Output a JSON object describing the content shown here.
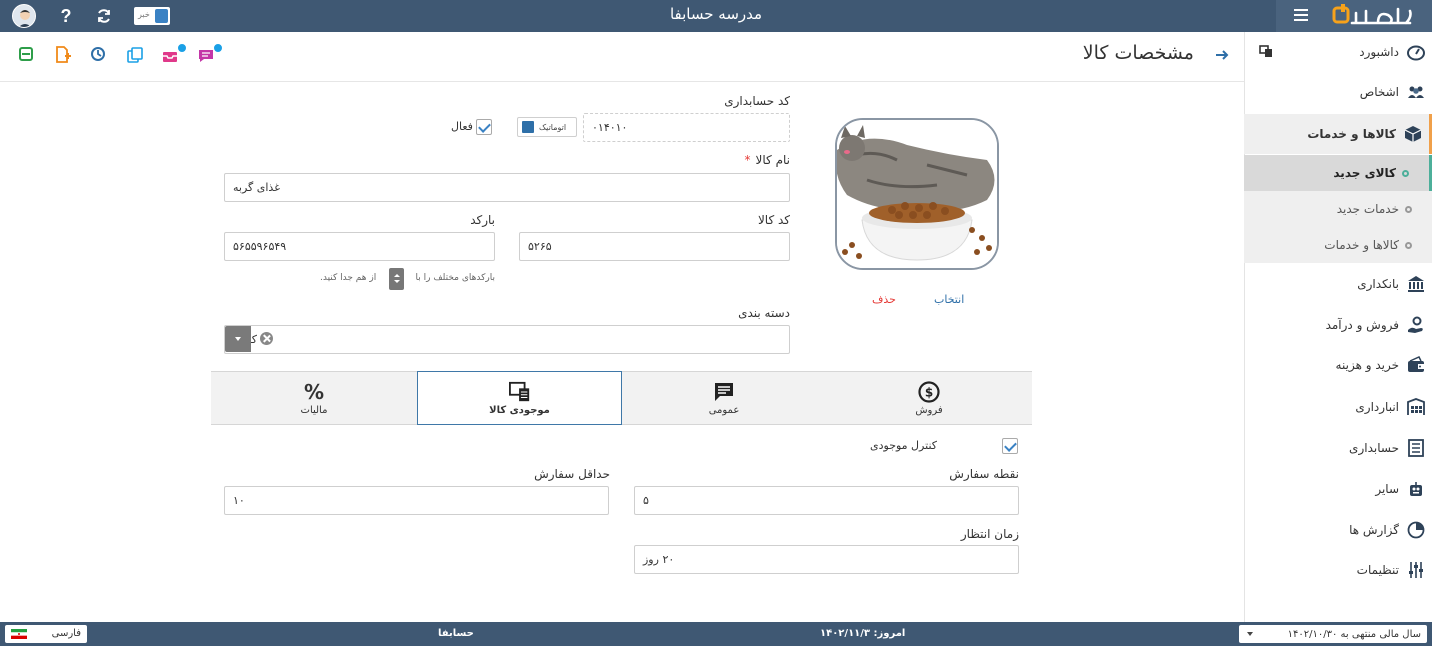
{
  "app": {
    "school_title": "مدرسه حسابفا",
    "logo_text": "حسابفا",
    "news_label": "خبر"
  },
  "sidebar": {
    "items": [
      {
        "label": "داشبورد",
        "icon": "dashboard-gauge-icon"
      },
      {
        "label": "اشخاص",
        "icon": "people-icon"
      },
      {
        "label": "کالاها و خدمات",
        "icon": "box-icon"
      },
      {
        "label": "بانکداری",
        "icon": "bank-icon"
      },
      {
        "label": "فروش و درآمد",
        "icon": "sales-icon"
      },
      {
        "label": "خرید و هزینه",
        "icon": "wallet-icon"
      },
      {
        "label": "انبارداری",
        "icon": "warehouse-icon"
      },
      {
        "label": "حسابداری",
        "icon": "ledger-icon"
      },
      {
        "label": "سایر",
        "icon": "robot-icon"
      },
      {
        "label": "گزارش ها",
        "icon": "report-chart-icon"
      },
      {
        "label": "تنظیمات",
        "icon": "settings-sliders-icon"
      }
    ],
    "sub_items": [
      {
        "label": "کالای جدید",
        "active": true
      },
      {
        "label": "خدمات جدید",
        "active": false
      },
      {
        "label": "کالاها و خدمات",
        "active": false
      }
    ]
  },
  "header": {
    "title": "مشخصات کالا"
  },
  "form": {
    "account_code_label": "کد حسابداری",
    "account_code_value": "۰۱۴۰۱۰",
    "auto_label": "اتوماتیک",
    "active_label": "فعال",
    "name_label": "نام کالا",
    "name_required": "*",
    "name_value": "غذای گربه",
    "code_label": "کد کالا",
    "code_value": "۵۲۶۵",
    "barcode_label": "بارکد",
    "barcode_value": "۵۶۵۵۹۶۵۴۹",
    "barcode_hint_a": "بارکدهای مختلف را با",
    "barcode_hint_b": "از هم جدا کنید.",
    "category_label": "دسته بندی",
    "category_value": "کالاها",
    "image_select": "انتخاب",
    "image_delete": "حذف"
  },
  "tabs": [
    {
      "label": "فروش",
      "icon": "dollar-circle-icon",
      "active": false
    },
    {
      "label": "عمومی",
      "icon": "message-icon",
      "active": false
    },
    {
      "label": "موجودی کالا",
      "icon": "inventory-icon",
      "active": true
    },
    {
      "label": "مالیات",
      "icon": "percent-icon",
      "active": false
    }
  ],
  "inventory": {
    "control_label": "کنترل موجودی",
    "reorder_point_label": "نقطه سفارش",
    "reorder_point_value": "۵",
    "min_order_label": "حداقل سفارش",
    "min_order_value": "۱۰",
    "lead_time_label": "زمان انتظار",
    "lead_time_value": "۲۰ روز"
  },
  "status_bar": {
    "fiscal_year": "سال مالی منتهی به ۱۴۰۲/۱۰/۳۰",
    "today": "امروز: ۱۴۰۲/۱۱/۳",
    "brand": "حسابفا",
    "language": "فارسی"
  },
  "colors": {
    "topbar": "#3f5873",
    "accent_blue": "#3a82c4",
    "menu_open_accent": "#f0a04a",
    "submenu_active_accent": "#4caf9a",
    "logo_orange": "#f7a21b",
    "delete_red": "#e53935"
  }
}
